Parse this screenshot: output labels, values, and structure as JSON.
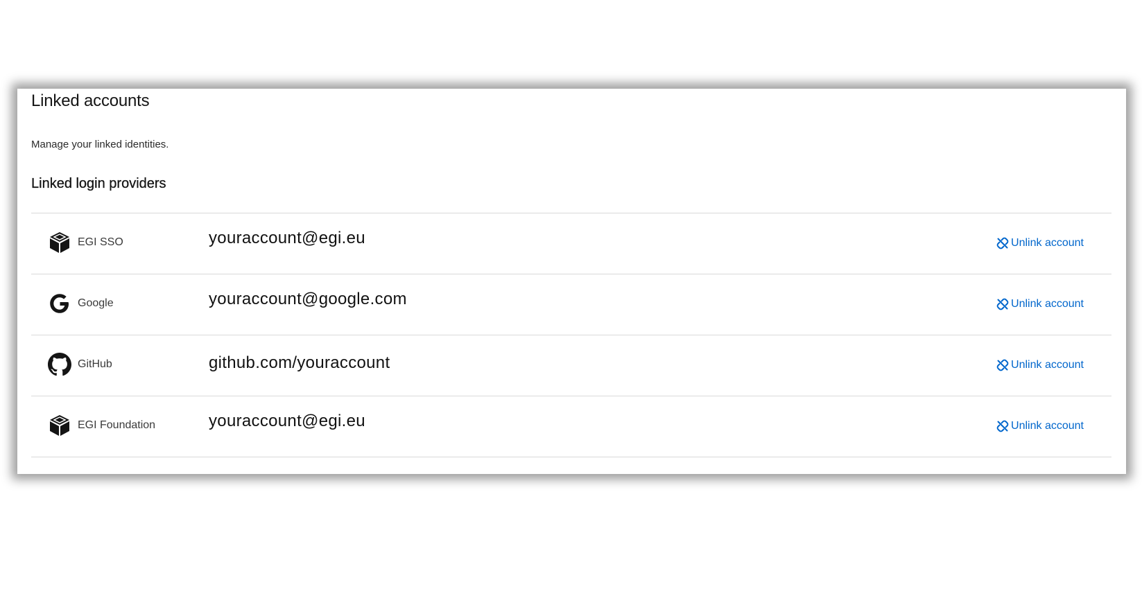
{
  "page": {
    "title": "Linked accounts",
    "subtitle": "Manage your linked identities.",
    "section_title": "Linked login providers"
  },
  "accounts": [
    {
      "provider": "EGI SSO",
      "icon": "cube-icon",
      "identity": "youraccount@egi.eu",
      "action": "Unlink account"
    },
    {
      "provider": "Google",
      "icon": "google-icon",
      "identity": "youraccount@google.com",
      "action": "Unlink account"
    },
    {
      "provider": "GitHub",
      "icon": "github-icon",
      "identity": "github.com/youraccount",
      "action": "Unlink account"
    },
    {
      "provider": "EGI Foundation",
      "icon": "cube-icon",
      "identity": "youraccount@egi.eu",
      "action": "Unlink account"
    }
  ],
  "colors": {
    "link": "#0066cc",
    "divider": "#d9d9d9",
    "text": "#151515"
  }
}
